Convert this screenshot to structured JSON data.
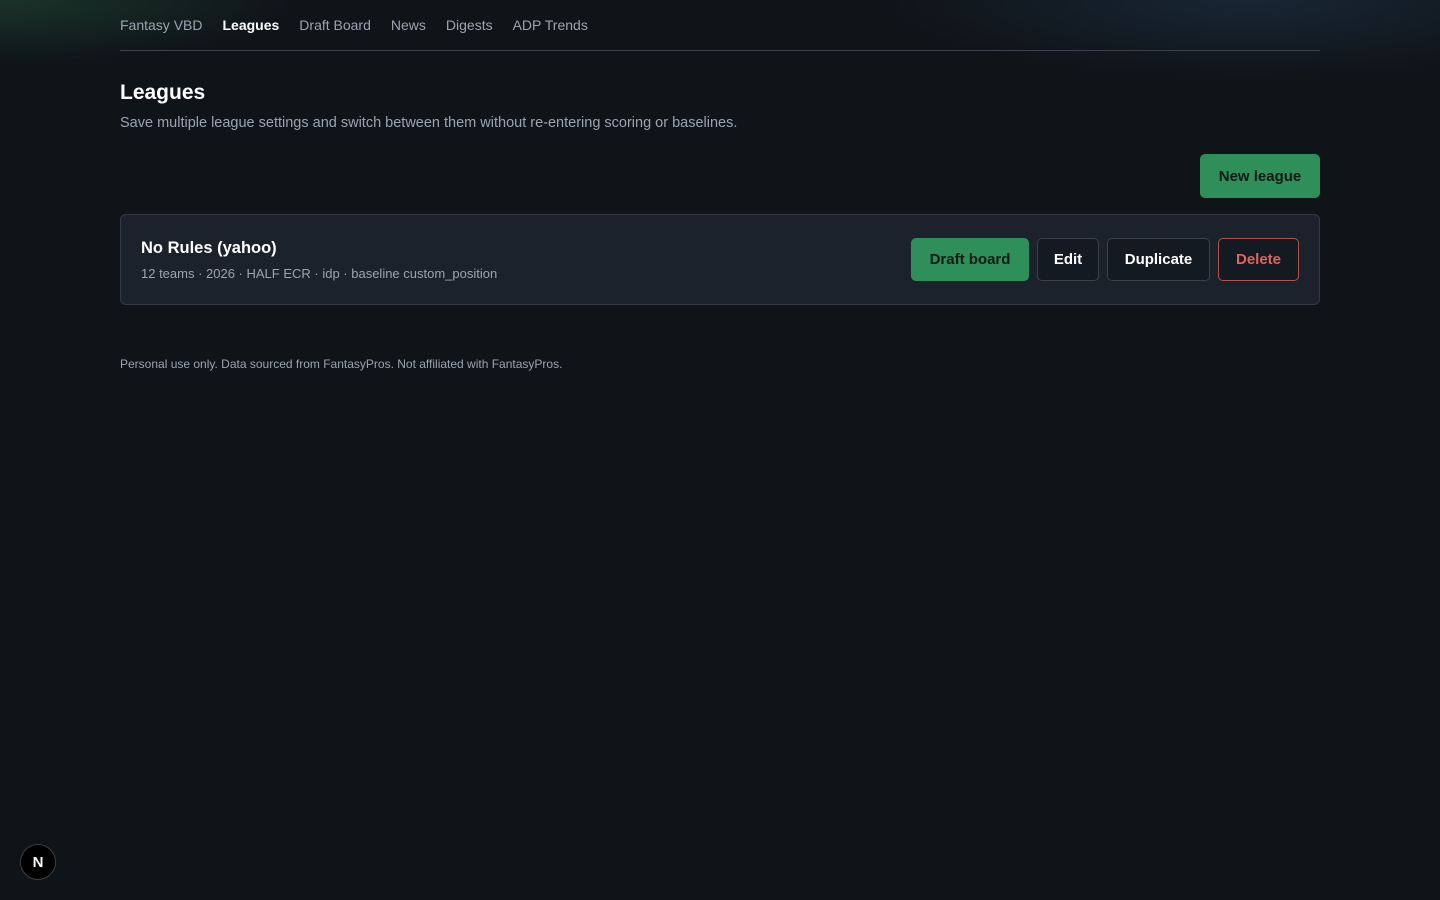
{
  "nav": {
    "items": [
      {
        "label": "Fantasy VBD",
        "active": false
      },
      {
        "label": "Leagues",
        "active": true
      },
      {
        "label": "Draft Board",
        "active": false
      },
      {
        "label": "News",
        "active": false
      },
      {
        "label": "Digests",
        "active": false
      },
      {
        "label": "ADP Trends",
        "active": false
      }
    ]
  },
  "page": {
    "title": "Leagues",
    "subtitle": "Save multiple league settings and switch between them without re-entering scoring or baselines.",
    "new_button": "New league"
  },
  "leagues": [
    {
      "name": "No Rules (yahoo)",
      "meta": "12 teams · 2026 · HALF ECR · idp · baseline custom_position",
      "actions": {
        "draft_board": "Draft board",
        "edit": "Edit",
        "duplicate": "Duplicate",
        "delete": "Delete"
      }
    }
  ],
  "footer": {
    "note": "Personal use only. Data sourced from FantasyPros. Not affiliated with FantasyPros."
  },
  "dev_badge": {
    "label": "N",
    "icon": "nextjs-icon"
  },
  "colors": {
    "background": "#0f1419",
    "accent_green": "#2f8f5b",
    "danger_red": "#e0645e",
    "card_bg": "#1b222b"
  }
}
